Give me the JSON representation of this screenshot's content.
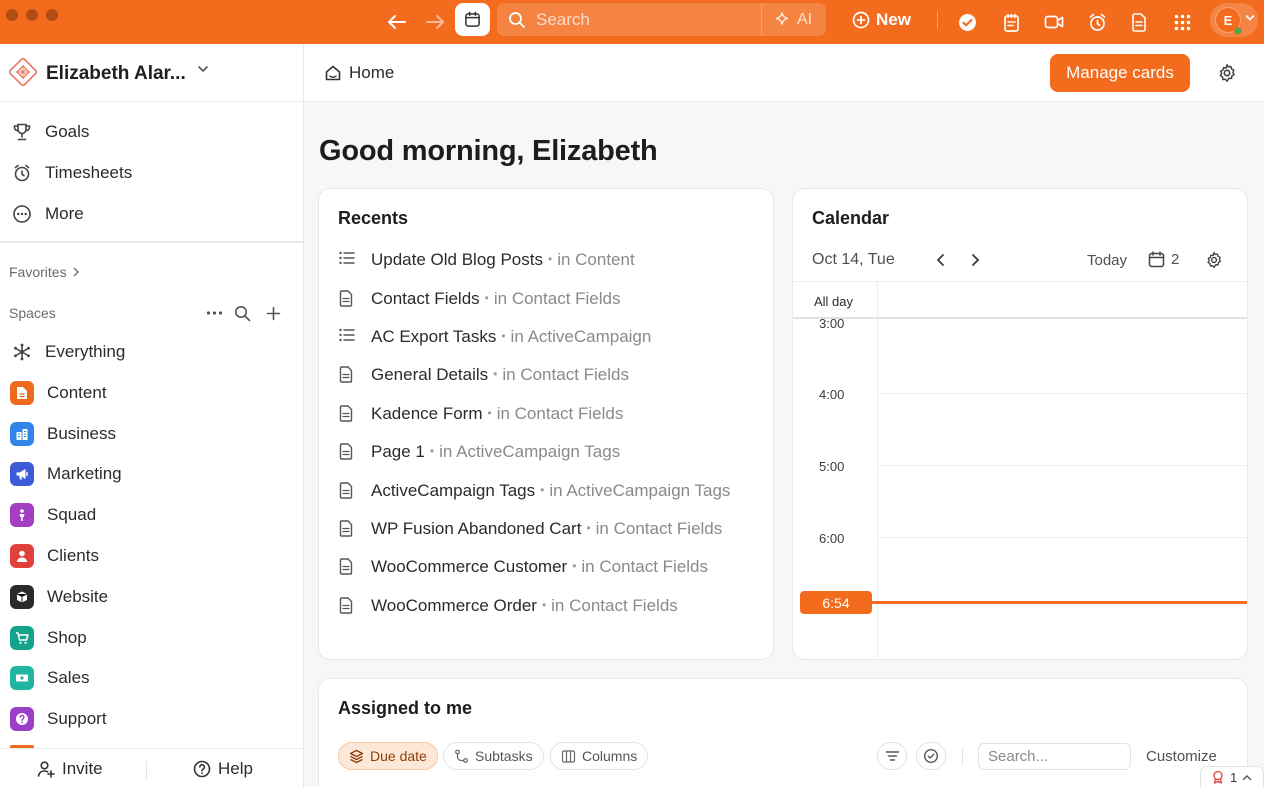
{
  "topbar": {
    "search_placeholder": "Search",
    "ai_label": "AI",
    "new_label": "New",
    "avatar_initial": "E"
  },
  "sidebar": {
    "workspace_name": "Elizabeth Alar...",
    "nav": [
      {
        "label": "Goals",
        "icon": "trophy-icon"
      },
      {
        "label": "Timesheets",
        "icon": "timer-icon"
      },
      {
        "label": "More",
        "icon": "more-circle-icon"
      }
    ],
    "favorites_label": "Favorites",
    "spaces_label": "Spaces",
    "spaces": [
      {
        "label": "Everything",
        "icon": "everything-icon",
        "color": ""
      },
      {
        "label": "Content",
        "icon": "document-icon",
        "color": "#ef6a1f"
      },
      {
        "label": "Business",
        "icon": "business-icon",
        "color": "#2f86e8"
      },
      {
        "label": "Marketing",
        "icon": "megaphone-icon",
        "color": "#3d5bd9"
      },
      {
        "label": "Squad",
        "icon": "person-icon",
        "color": "#a43fc4"
      },
      {
        "label": "Clients",
        "icon": "user-icon",
        "color": "#e0413b"
      },
      {
        "label": "Website",
        "icon": "box-icon",
        "color": "#2b2b2b"
      },
      {
        "label": "Shop",
        "icon": "cart-icon",
        "color": "#14a38b"
      },
      {
        "label": "Sales",
        "icon": "money-icon",
        "color": "#1fb5a0"
      },
      {
        "label": "Support",
        "icon": "help-icon",
        "color": "#9b3fc8"
      }
    ],
    "invite_label": "Invite",
    "help_label": "Help"
  },
  "header": {
    "breadcrumb": "Home",
    "manage_cards_label": "Manage cards"
  },
  "greeting": "Good morning, Elizabeth",
  "recents": {
    "title": "Recents",
    "items": [
      {
        "name": "Update Old Blog Posts",
        "location": "in Content",
        "icon": "list-icon"
      },
      {
        "name": "Contact Fields",
        "location": "in Contact Fields",
        "icon": "doc-icon"
      },
      {
        "name": "AC Export Tasks",
        "location": "in ActiveCampaign",
        "icon": "list-icon"
      },
      {
        "name": "General Details",
        "location": "in Contact Fields",
        "icon": "doc-icon"
      },
      {
        "name": "Kadence Form",
        "location": "in Contact Fields",
        "icon": "doc-icon"
      },
      {
        "name": "Page 1",
        "location": "in ActiveCampaign Tags",
        "icon": "doc-icon"
      },
      {
        "name": "ActiveCampaign Tags",
        "location": "in ActiveCampaign Tags",
        "icon": "doc-icon"
      },
      {
        "name": "WP Fusion Abandoned Cart",
        "location": "in Contact Fields",
        "icon": "doc-icon"
      },
      {
        "name": "WooCommerce Customer",
        "location": "in Contact Fields",
        "icon": "doc-icon"
      },
      {
        "name": "WooCommerce Order",
        "location": "in Contact Fields",
        "icon": "doc-icon"
      }
    ]
  },
  "calendar": {
    "title": "Calendar",
    "date": "Oct 14, Tue",
    "today_label": "Today",
    "count": "2",
    "all_day_label": "All day",
    "hours": [
      "3:00",
      "4:00",
      "5:00",
      "6:00"
    ],
    "now_label": "6:54"
  },
  "assigned": {
    "title": "Assigned to me",
    "chips": [
      "Due date",
      "Subtasks",
      "Columns"
    ],
    "search_placeholder": "Search...",
    "customize_label": "Customize"
  },
  "corner_badge": "1",
  "colors": {
    "accent": "#f36b1c"
  }
}
